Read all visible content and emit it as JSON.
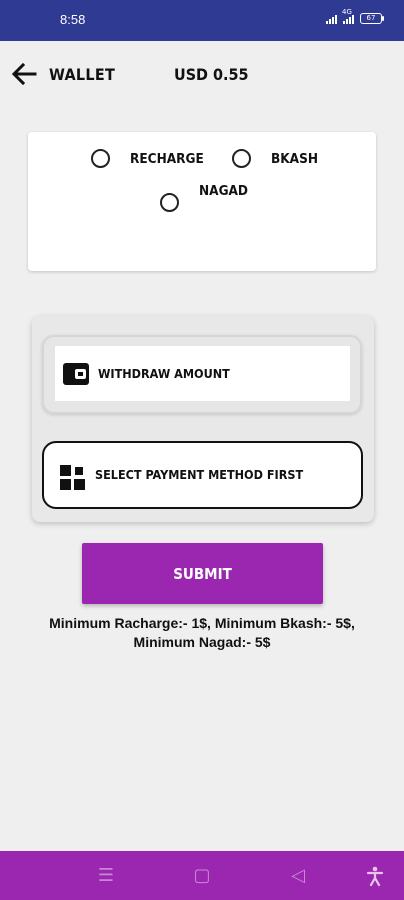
{
  "status_bar": {
    "time": "8:58",
    "network_label": "4G",
    "battery": "67"
  },
  "header": {
    "title": "WALLET",
    "balance": "USD 0.55"
  },
  "payment_methods": {
    "options": [
      {
        "label": "RECHARGE",
        "selected": false
      },
      {
        "label": "BKASH",
        "selected": false
      },
      {
        "label": "NAGAD",
        "selected": false
      }
    ]
  },
  "form": {
    "amount_placeholder": "WITHDRAW AMOUNT",
    "payment_placeholder": "SELECT PAYMENT METHOD FIRST"
  },
  "submit_label": "SUBMIT",
  "minimum_note": "Minimum Racharge:- 1$, Minimum Bkash:- 5$, Minimum Nagad:- 5$",
  "colors": {
    "status_bar": "#2f3a93",
    "accent": "#9b27b0",
    "background": "#efefef"
  },
  "icons": {
    "back": "arrow-left-icon",
    "wallet": "wallet-icon",
    "grid": "grid-icon",
    "nav_menu": "menu-icon",
    "nav_home": "home-square-icon",
    "nav_back": "back-triangle-icon",
    "nav_accessibility": "accessibility-icon"
  }
}
